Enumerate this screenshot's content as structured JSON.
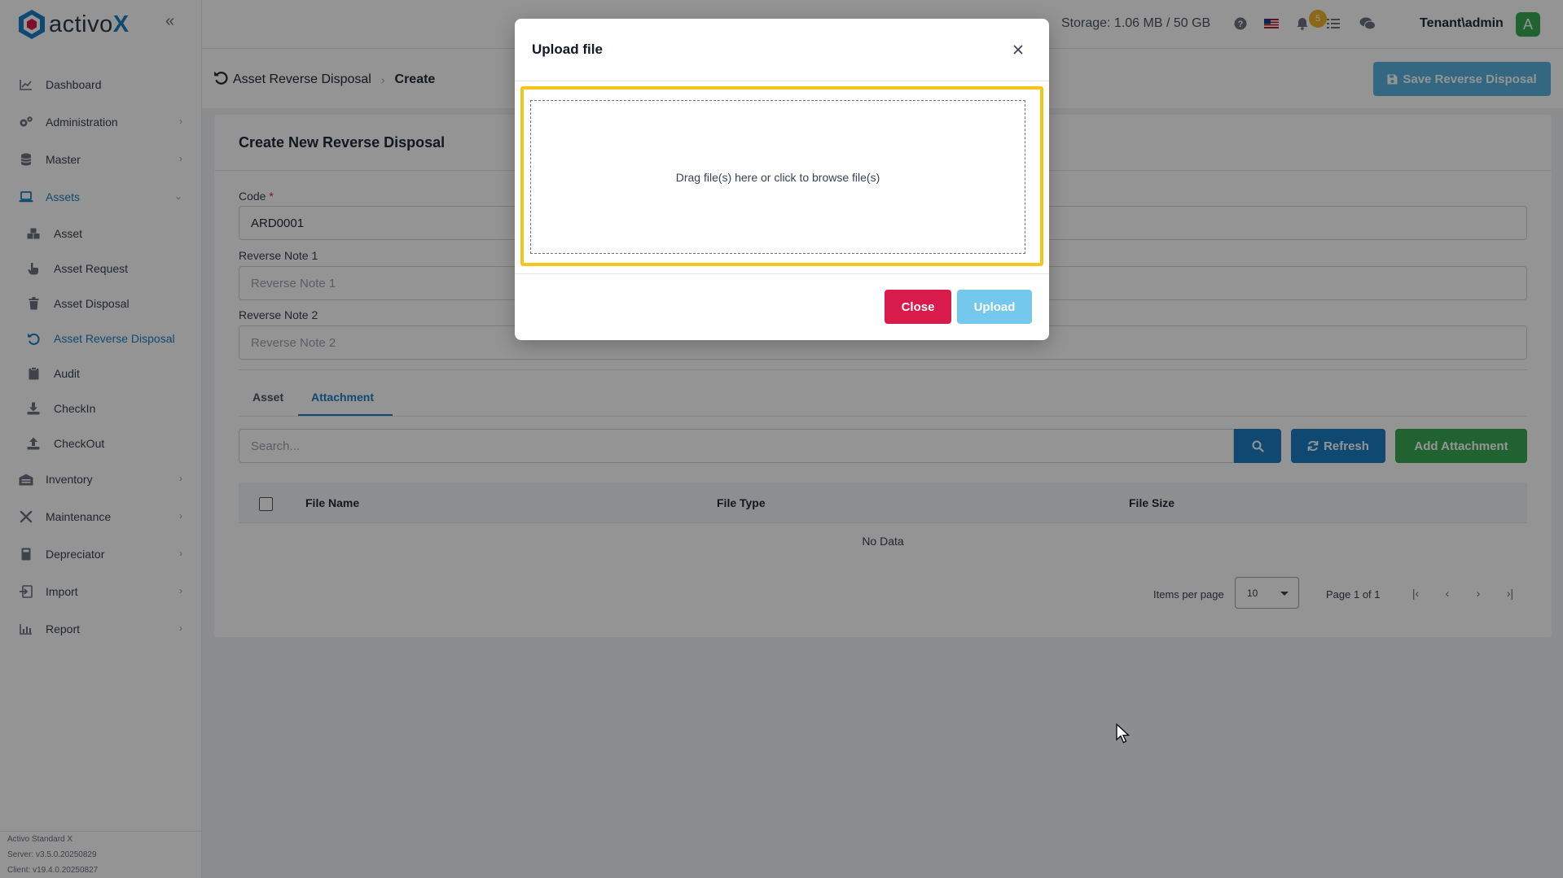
{
  "app": {
    "logo_text_main": "activo",
    "logo_text_x": "X",
    "collapse_icon": "double-chevron-left-icon"
  },
  "sidebar": {
    "items": [
      {
        "label": "Dashboard",
        "icon": "chart-line-icon",
        "has_children": false
      },
      {
        "label": "Administration",
        "icon": "gears-icon",
        "has_children": true
      },
      {
        "label": "Master",
        "icon": "database-icon",
        "has_children": true
      },
      {
        "label": "Assets",
        "icon": "laptop-icon",
        "has_children": true,
        "expanded": true,
        "active": true
      },
      {
        "label": "Inventory",
        "icon": "warehouse-icon",
        "has_children": true
      },
      {
        "label": "Maintenance",
        "icon": "tools-icon",
        "has_children": true
      },
      {
        "label": "Depreciator",
        "icon": "calculator-icon",
        "has_children": true
      },
      {
        "label": "Import",
        "icon": "import-icon",
        "has_children": true
      },
      {
        "label": "Report",
        "icon": "bar-chart-icon",
        "has_children": true
      }
    ],
    "asset_sub_items": [
      {
        "label": "Asset",
        "icon": "boxes-icon"
      },
      {
        "label": "Asset Request",
        "icon": "hand-pointer-icon"
      },
      {
        "label": "Asset Disposal",
        "icon": "trash-icon"
      },
      {
        "label": "Asset Reverse Disposal",
        "icon": "undo-icon",
        "active": true
      },
      {
        "label": "Audit",
        "icon": "clipboard-icon"
      },
      {
        "label": "CheckIn",
        "icon": "download-icon"
      },
      {
        "label": "CheckOut",
        "icon": "upload-icon"
      }
    ],
    "version": {
      "product": "Activo Standard X",
      "server": "Server: v3.5.0.20250829",
      "client": "Client: v19.4.0.20250827"
    }
  },
  "topbar": {
    "storage": "Storage: 1.06 MB / 50 GB",
    "notification_count": "5",
    "user": "Tenant\\admin",
    "avatar_letter": "A"
  },
  "breadcrumb": {
    "parent": "Asset Reverse Disposal",
    "current": "Create"
  },
  "page": {
    "save_label": "Save Reverse Disposal",
    "card_title": "Create New Reverse Disposal",
    "code_label": "Code",
    "code_required": "*",
    "code_value": "ARD0001",
    "note1_label": "Reverse Note 1",
    "note1_placeholder": "Reverse Note 1",
    "note2_label": "Reverse Note 2",
    "note2_placeholder": "Reverse Note 2",
    "tabs": [
      "Asset",
      "Attachment"
    ],
    "active_tab": "Attachment",
    "search_placeholder": "Search...",
    "refresh_label": "Refresh",
    "add_attachment_label": "Add Attachment",
    "columns": [
      "File Name",
      "File Type",
      "File Size"
    ],
    "no_data": "No Data",
    "items_per_page_label": "Items per page",
    "items_per_page_value": "10",
    "page_info": "Page 1 of 1"
  },
  "modal": {
    "title": "Upload file",
    "dropzone_text": "Drag file(s) here or click to browse file(s)",
    "close_label": "Close",
    "upload_label": "Upload"
  },
  "colors": {
    "brand_blue": "#1b7fc4",
    "success_green": "#3aaa55",
    "danger_red": "#d81b4a",
    "highlight_yellow": "#f5c518",
    "upload_disabled": "#74c8ee"
  }
}
